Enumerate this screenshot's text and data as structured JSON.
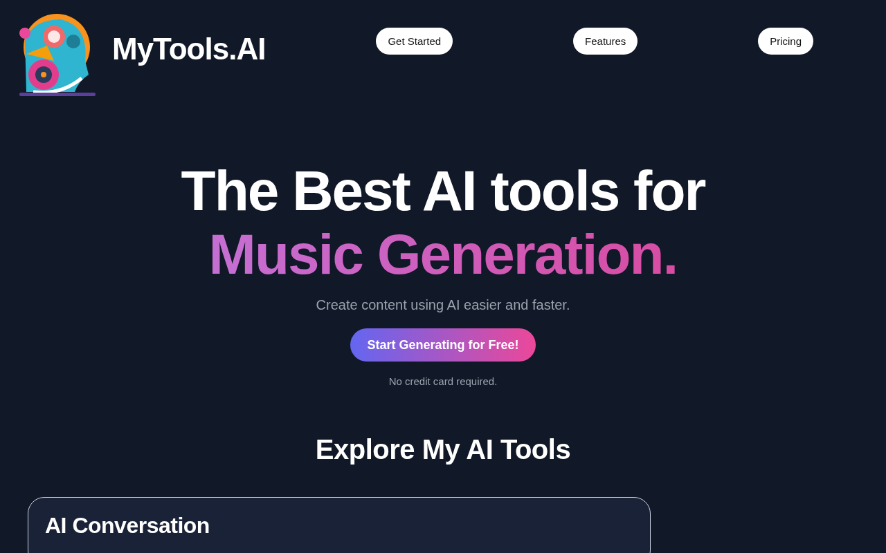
{
  "header": {
    "brand": "MyTools.AI",
    "nav": [
      "Get Started",
      "Features",
      "Pricing"
    ]
  },
  "hero": {
    "title_line": "The Best AI tools for",
    "highlight": "Music Generation.",
    "subtitle": "Create content using AI easier and faster.",
    "cta": "Start Generating for Free!",
    "note": "No credit card required."
  },
  "tools": {
    "heading": "Explore My AI Tools",
    "cards": [
      {
        "title": "AI Conversation"
      }
    ]
  }
}
